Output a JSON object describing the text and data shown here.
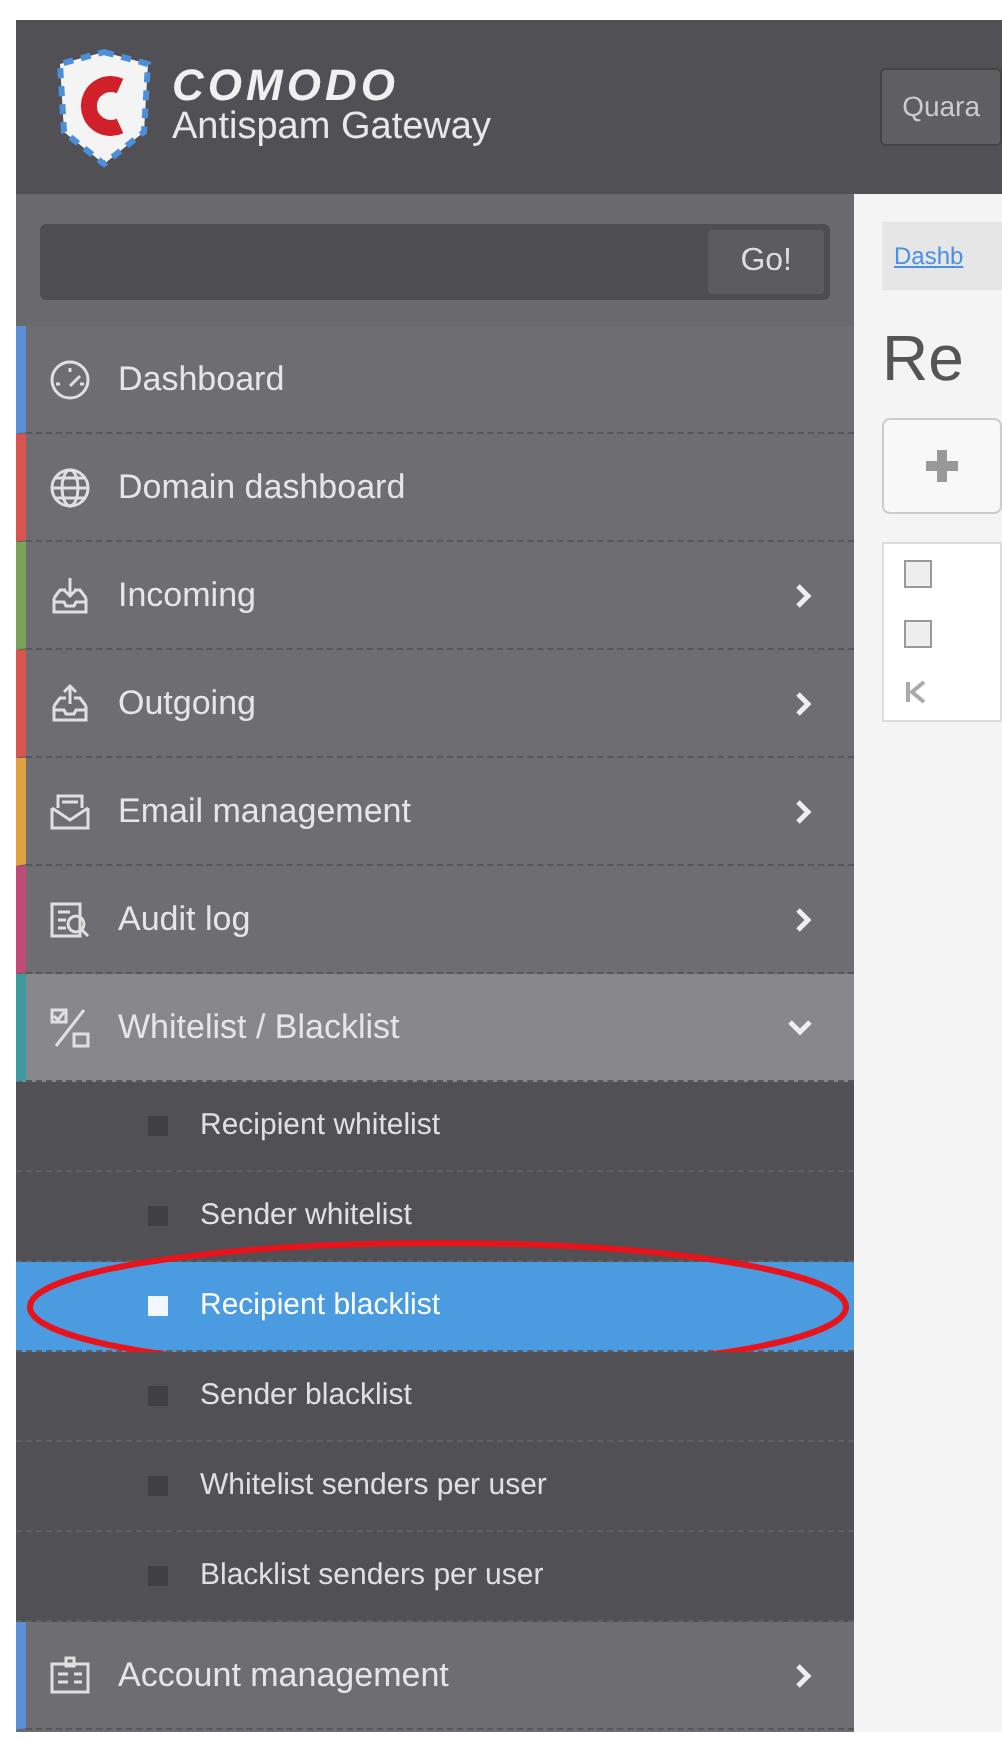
{
  "header": {
    "brand": "COMODO",
    "product": "Antispam Gateway",
    "button": "Quara"
  },
  "search": {
    "button": "Go!"
  },
  "menu": [
    {
      "label": "Dashboard",
      "color": "#5b8fd9",
      "expandable": false,
      "expanded": false
    },
    {
      "label": "Domain dashboard",
      "color": "#d9534f",
      "expandable": false,
      "expanded": false
    },
    {
      "label": "Incoming",
      "color": "#7aa35a",
      "expandable": true,
      "expanded": false
    },
    {
      "label": "Outgoing",
      "color": "#d9534f",
      "expandable": true,
      "expanded": false
    },
    {
      "label": "Email management",
      "color": "#e0a040",
      "expandable": true,
      "expanded": false
    },
    {
      "label": "Audit log",
      "color": "#c04a78",
      "expandable": true,
      "expanded": false
    },
    {
      "label": "Whitelist / Blacklist",
      "color": "#3d9aa0",
      "expandable": true,
      "expanded": true,
      "children": [
        {
          "label": "Recipient whitelist",
          "selected": false
        },
        {
          "label": "Sender whitelist",
          "selected": false
        },
        {
          "label": "Recipient blacklist",
          "selected": true
        },
        {
          "label": "Sender blacklist",
          "selected": false
        },
        {
          "label": "Whitelist senders per user",
          "selected": false
        },
        {
          "label": "Blacklist senders per user",
          "selected": false
        }
      ]
    },
    {
      "label": "Account management",
      "color": "#5b8fd9",
      "expandable": true,
      "expanded": false
    }
  ],
  "content": {
    "breadcrumb": "Dashb",
    "heading": "Re",
    "rows": [
      {
        "checked": false
      },
      {
        "checked": false
      }
    ]
  }
}
